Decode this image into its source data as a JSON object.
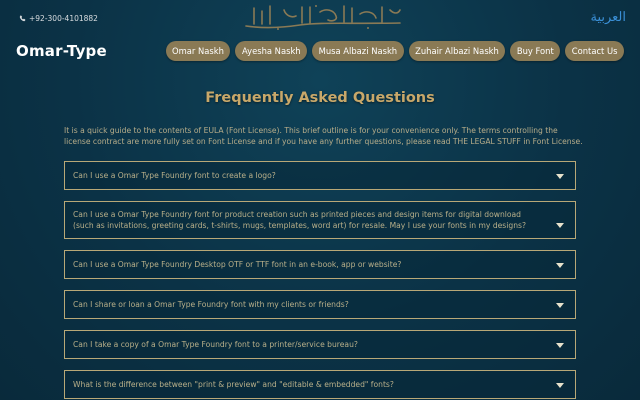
{
  "topbar": {
    "phone": "+92-300-4101882",
    "calligraphy_icon": "bismillah-calligraphy",
    "lang_link": "العربية"
  },
  "brand": "Omar-Type",
  "nav": [
    {
      "label": "Omar Naskh"
    },
    {
      "label": "Ayesha Naskh"
    },
    {
      "label": "Musa Albazi Naskh"
    },
    {
      "label": "Zuhair Albazi Naskh"
    },
    {
      "label": "Buy Font"
    },
    {
      "label": "Contact Us"
    }
  ],
  "faq": {
    "title": "Frequently Asked Questions",
    "intro": "It is a quick guide to the contents of EULA (Font License). This brief outline is for your convenience only. The terms controlling the license contract are more fully set on Font License and if you have any further questions, please read THE LEGAL STUFF in Font License.",
    "items": [
      {
        "q": "Can I use a Omar Type Foundry font to create a logo?"
      },
      {
        "q": "Can I use a Omar Type Foundry font for product creation such as printed pieces and design items for digital download (such as invitations, greeting cards, t-shirts, mugs, templates, word art) for resale. May I use your fonts in my designs?"
      },
      {
        "q": "Can I use a Omar Type Foundry Desktop OTF or TTF font in an e-book, app or website?"
      },
      {
        "q": "Can I share or loan a Omar Type Foundry font with my clients or friends?"
      },
      {
        "q": "Can I take a copy of a Omar Type Foundry font to a printer/service bureau?"
      },
      {
        "q": "What is the difference between \"print & preview\" and \"editable & embedded\" fonts?"
      }
    ]
  },
  "colors": {
    "background": "#0c3548",
    "accent_gold": "#c8a86a",
    "nav_button": "#8a7a55",
    "link_blue": "#3a8fd6"
  }
}
